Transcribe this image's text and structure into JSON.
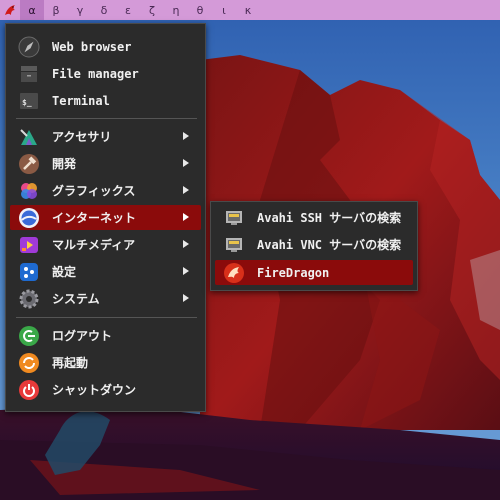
{
  "topbar": {
    "workspaces": [
      "α",
      "β",
      "γ",
      "δ",
      "ε",
      "ζ",
      "η",
      "θ",
      "ι",
      "κ"
    ],
    "active_index": 0
  },
  "menu": {
    "items": [
      {
        "label": "Web browser",
        "icon": "compass-icon"
      },
      {
        "label": "File manager",
        "icon": "file-manager-icon"
      },
      {
        "label": "Terminal",
        "icon": "terminal-icon"
      },
      {
        "label": "アクセサリ",
        "icon": "accessories-icon"
      },
      {
        "label": "開発",
        "icon": "hammer-icon"
      },
      {
        "label": "グラフィックス",
        "icon": "graphics-icon"
      },
      {
        "label": "インターネット",
        "icon": "internet-icon"
      },
      {
        "label": "マルチメディア",
        "icon": "multimedia-icon"
      },
      {
        "label": "設定",
        "icon": "settings-icon"
      },
      {
        "label": "システム",
        "icon": "gear-icon"
      },
      {
        "label": "ログアウト",
        "icon": "logout-icon"
      },
      {
        "label": "再起動",
        "icon": "restart-icon"
      },
      {
        "label": "シャットダウン",
        "icon": "power-icon"
      }
    ]
  },
  "submenu": {
    "items": [
      {
        "label": "Avahi SSH サーバの検索",
        "icon": "network-icon"
      },
      {
        "label": "Avahi VNC サーバの検索",
        "icon": "network-icon"
      },
      {
        "label": "FireDragon",
        "icon": "firedragon-icon"
      }
    ]
  },
  "colors": {
    "topbar": "#d49ad8",
    "menu_bg": "#2b2b2b",
    "selection": "#8b0b0b"
  }
}
